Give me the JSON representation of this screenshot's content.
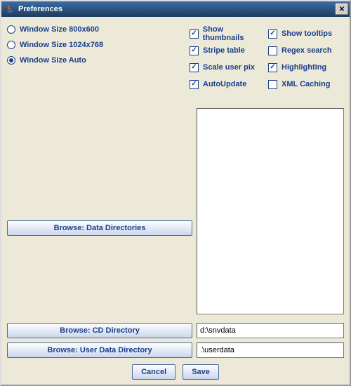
{
  "window": {
    "title": "Preferences"
  },
  "radios": {
    "r0": {
      "label": "Window Size 800x600",
      "selected": false
    },
    "r1": {
      "label": "Window Size 1024x768",
      "selected": false
    },
    "r2": {
      "label": "Window Size Auto",
      "selected": true
    }
  },
  "checks": {
    "thumbnails": {
      "label": "Show thumbnails",
      "checked": true
    },
    "tooltips": {
      "label": "Show tooltips",
      "checked": true
    },
    "stripe": {
      "label": "Stripe table",
      "checked": true
    },
    "regex": {
      "label": "Regex search",
      "checked": false
    },
    "scalepix": {
      "label": "Scale user pix",
      "checked": true
    },
    "highlight": {
      "label": "Highlighting",
      "checked": true
    },
    "autoupdate": {
      "label": "AutoUpdate",
      "checked": true
    },
    "xmlcache": {
      "label": "XML Caching",
      "checked": false
    }
  },
  "buttons": {
    "browseDataDirs": "Browse: Data Directories",
    "browseCdDir": "Browse: CD Directory",
    "browseUserDir": "Browse: User Data Directory",
    "cancel": "Cancel",
    "save": "Save"
  },
  "fields": {
    "cdDir": "d:\\snvdata",
    "userDir": ".\\userdata"
  }
}
